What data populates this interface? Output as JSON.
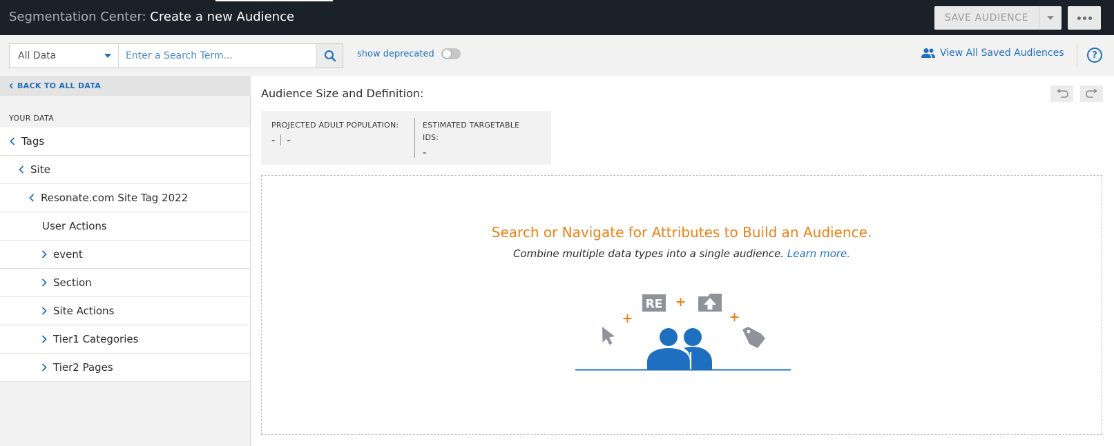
{
  "header": {
    "title_prefix": "Segmentation Center:",
    "title_main": "Create a new Audience",
    "save_label": "SAVE AUDIENCE",
    "more_icon": "more-horizontal-icon"
  },
  "search": {
    "dataset_value": "All Data",
    "placeholder": "Enter a Search Term...",
    "show_deprecated_label": "show deprecated",
    "show_deprecated_on": false,
    "view_all_label": "View All Saved Audiences"
  },
  "sidebar": {
    "back_label": "BACK TO ALL DATA",
    "section_label": "YOUR DATA",
    "items": [
      {
        "label": "Tags",
        "chevron": "left"
      },
      {
        "label": "Site",
        "chevron": "left"
      },
      {
        "label": "Resonate.com Site Tag 2022",
        "chevron": "left"
      },
      {
        "label": "User Actions",
        "chevron": "none"
      },
      {
        "label": "event",
        "chevron": "right"
      },
      {
        "label": "Section",
        "chevron": "right"
      },
      {
        "label": "Site Actions",
        "chevron": "right"
      },
      {
        "label": "Tier1 Categories",
        "chevron": "right"
      },
      {
        "label": "Tier2 Pages",
        "chevron": "right"
      }
    ]
  },
  "main": {
    "heading": "Audience Size and Definition:",
    "stat1_label": "PROJECTED ADULT POPULATION:",
    "stat1_value_a": "-",
    "stat1_value_b": "-",
    "stat2_label": "ESTIMATED TARGETABLE IDS:",
    "stat2_value": "-",
    "empty_title": "Search or Navigate for Attributes to Build an Audience.",
    "empty_sub": "Combine multiple data types into a single audience.",
    "learn_more": "Learn more.",
    "illustration_badge": "RE"
  },
  "colors": {
    "topbar_bg": "#1b2129",
    "accent_blue": "#1f6fc0",
    "accent_orange": "#ef7e10",
    "icon_gray": "#8f9399"
  }
}
